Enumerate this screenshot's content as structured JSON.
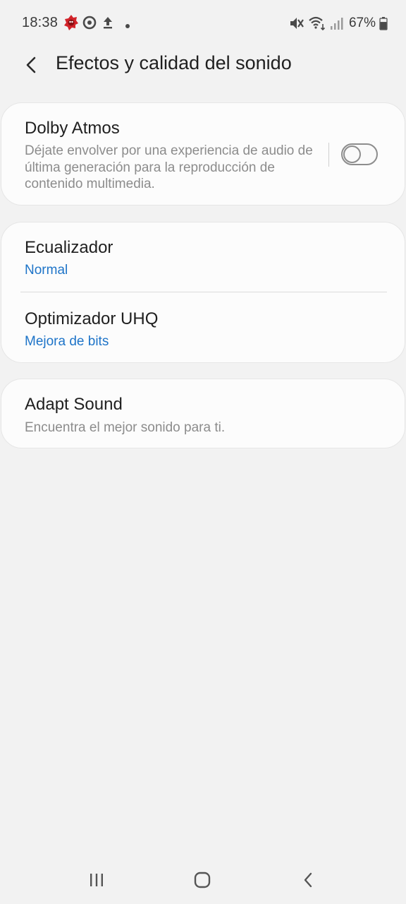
{
  "status_bar": {
    "time": "18:38",
    "battery_percent": "67%",
    "left_icons": [
      "antutu-icon",
      "media-play-icon",
      "upload-icon",
      "notification-dot-icon"
    ],
    "right_icons": [
      "mute-icon",
      "wifi-icon",
      "signal-icon",
      "battery-icon"
    ],
    "battery_level": 0.67
  },
  "header": {
    "title": "Efectos y calidad del sonido"
  },
  "dolby": {
    "title": "Dolby Atmos",
    "description": "Déjate envolver por una experiencia de audio de última generación para la reproducción de contenido multimedia.",
    "enabled": false
  },
  "equalizer": {
    "title": "Ecualizador",
    "value": "Normal"
  },
  "uhq": {
    "title": "Optimizador UHQ",
    "value": "Mejora de bits"
  },
  "adapt_sound": {
    "title": "Adapt Sound",
    "description": "Encuentra el mejor sonido para ti."
  },
  "colors": {
    "background": "#f2f2f2",
    "card": "#fcfcfc",
    "accent": "#1e74c8",
    "secondary_text": "#8c8c8c"
  }
}
